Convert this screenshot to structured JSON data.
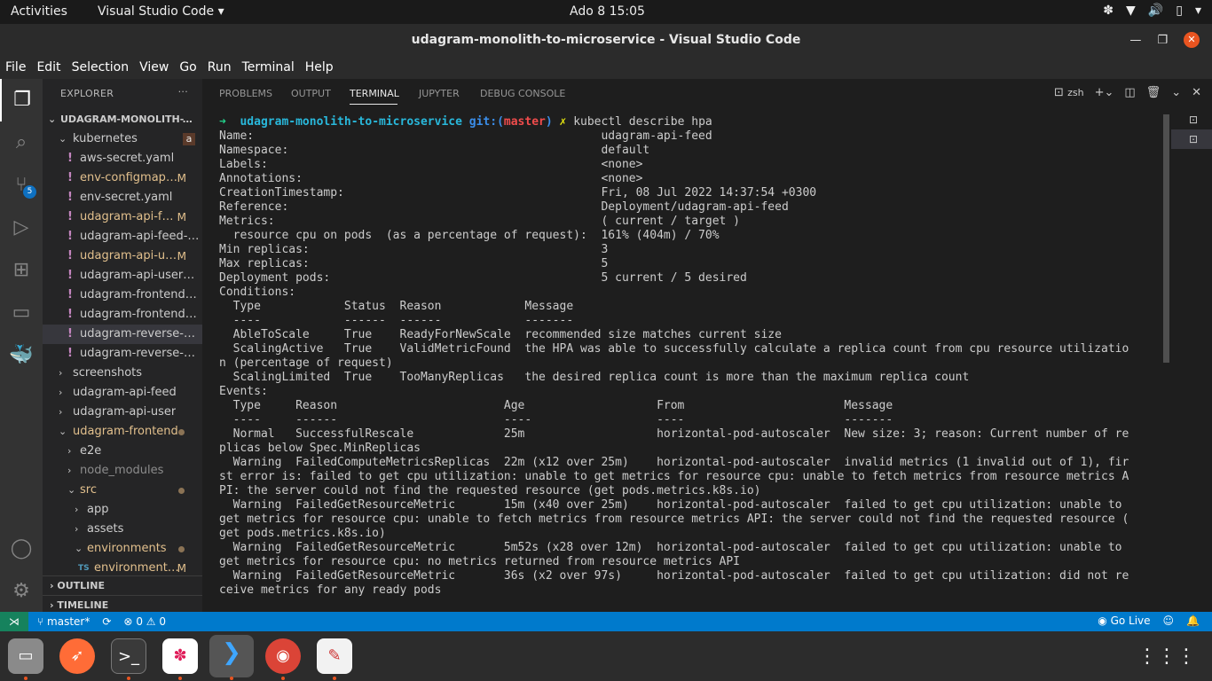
{
  "topbar": {
    "activities": "Activities",
    "app": "Visual Studio Code ▾",
    "clock": "Ado 8  15:05"
  },
  "window": {
    "title": "udagram-monolith-to-microservice - Visual Studio Code"
  },
  "menu": [
    "File",
    "Edit",
    "Selection",
    "View",
    "Go",
    "Run",
    "Terminal",
    "Help"
  ],
  "activity_icons": [
    "explorer-icon",
    "search-icon",
    "source-control-icon",
    "run-debug-icon",
    "extensions-icon",
    "remote-explorer-icon",
    "docker-icon",
    "account-icon",
    "settings-gear-icon"
  ],
  "scm_badge": "5",
  "explorer": {
    "title": "EXPLORER",
    "root": "UDAGRAM-MONOLITH-TO-...",
    "items": [
      {
        "name": "kubernetes",
        "badge": "a"
      },
      {
        "name": "aws-secret.yaml",
        "status": ""
      },
      {
        "name": "env-configmap....",
        "status": "M"
      },
      {
        "name": "env-secret.yaml",
        "status": ""
      },
      {
        "name": "udagram-api-fe...",
        "status": "M"
      },
      {
        "name": "udagram-api-feed-se...",
        "status": ""
      },
      {
        "name": "udagram-api-us...",
        "status": "M"
      },
      {
        "name": "udagram-api-users-s...",
        "status": ""
      },
      {
        "name": "udagram-frontend-d...",
        "status": ""
      },
      {
        "name": "udagram-frontend-s...",
        "status": ""
      },
      {
        "name": "udagram-reverse-pr...",
        "status": ""
      },
      {
        "name": "udagram-reverse-pr...",
        "status": ""
      },
      {
        "name": "screenshots"
      },
      {
        "name": "udagram-api-feed"
      },
      {
        "name": "udagram-api-user"
      },
      {
        "name": "udagram-frontend"
      },
      {
        "name": "e2e"
      },
      {
        "name": "node_modules"
      },
      {
        "name": "src"
      },
      {
        "name": "app"
      },
      {
        "name": "assets"
      },
      {
        "name": "environments"
      },
      {
        "name": "environment....",
        "status": "M",
        "prefix": "TS"
      }
    ],
    "outline": "OUTLINE",
    "timeline": "TIMELINE"
  },
  "panel": {
    "tabs": [
      "PROBLEMS",
      "OUTPUT",
      "TERMINAL",
      "JUPYTER",
      "DEBUG CONSOLE"
    ],
    "active_tab": "TERMINAL",
    "shell": "zsh"
  },
  "terminal": {
    "prompt_arrow": "➜",
    "prompt_dir": "udagram-monolith-to-microservice",
    "git_prefix": "git:(",
    "branch": "master",
    "git_suffix": ")",
    "dirty": "✗",
    "command": "kubectl describe hpa",
    "lines": [
      "Name:                                                  udagram-api-feed",
      "Namespace:                                             default",
      "Labels:                                                <none>",
      "Annotations:                                           <none>",
      "CreationTimestamp:                                     Fri, 08 Jul 2022 14:37:54 +0300",
      "Reference:                                             Deployment/udagram-api-feed",
      "Metrics:                                               ( current / target )",
      "  resource cpu on pods  (as a percentage of request):  161% (404m) / 70%",
      "Min replicas:                                          3",
      "Max replicas:                                          5",
      "Deployment pods:                                       5 current / 5 desired",
      "Conditions:",
      "  Type            Status  Reason            Message",
      "  ----            ------  ------            -------",
      "  AbleToScale     True    ReadyForNewScale  recommended size matches current size",
      "  ScalingActive   True    ValidMetricFound  the HPA was able to successfully calculate a replica count from cpu resource utilizatio",
      "n (percentage of request)",
      "  ScalingLimited  True    TooManyReplicas   the desired replica count is more than the maximum replica count",
      "Events:",
      "  Type     Reason                        Age                   From                       Message",
      "  ----     ------                        ----                  ----                       -------",
      "  Normal   SuccessfulRescale             25m                   horizontal-pod-autoscaler  New size: 3; reason: Current number of re",
      "plicas below Spec.MinReplicas",
      "  Warning  FailedComputeMetricsReplicas  22m (x12 over 25m)    horizontal-pod-autoscaler  invalid metrics (1 invalid out of 1), fir",
      "st error is: failed to get cpu utilization: unable to get metrics for resource cpu: unable to fetch metrics from resource metrics A",
      "PI: the server could not find the requested resource (get pods.metrics.k8s.io)",
      "  Warning  FailedGetResourceMetric       15m (x40 over 25m)    horizontal-pod-autoscaler  failed to get cpu utilization: unable to",
      "get metrics for resource cpu: unable to fetch metrics from resource metrics API: the server could not find the requested resource (",
      "get pods.metrics.k8s.io)",
      "  Warning  FailedGetResourceMetric       5m52s (x28 over 12m)  horizontal-pod-autoscaler  failed to get cpu utilization: unable to",
      "get metrics for resource cpu: no metrics returned from resource metrics API",
      "  Warning  FailedGetResourceMetric       36s (x2 over 97s)     horizontal-pod-autoscaler  failed to get cpu utilization: did not re",
      "ceive metrics for any ready pods"
    ]
  },
  "statusbar": {
    "branch": "master*",
    "errors": "0",
    "warnings": "0",
    "golive": "Go Live"
  },
  "dock": [
    "files-icon",
    "postman-icon",
    "terminal-icon",
    "slack-icon",
    "vscode-icon",
    "chrome-icon",
    "text-editor-icon",
    "app-grid-icon"
  ],
  "colors": {
    "accent": "#007acc",
    "remote": "#16825d",
    "ubuntu": "#e95420"
  }
}
